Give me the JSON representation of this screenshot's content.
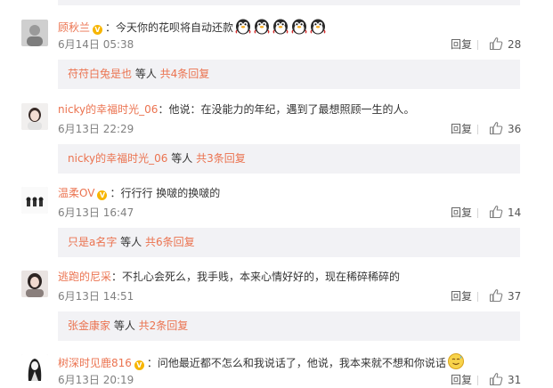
{
  "comments": [
    {
      "username": "顾秋兰",
      "text": "：今天你的花呗将自动还款",
      "emoji_count": 5,
      "time": "6月14日 05:38",
      "reply_label": "回复",
      "likes": "28",
      "sub": {
        "name": "苻苻白兔是也",
        "mid": " 等人 ",
        "total": "共4条回复"
      }
    },
    {
      "username": "nicky的幸福时光_06",
      "text": "：他说：在没能力的年纪，遇到了最想照顾一生的人。",
      "time": "6月13日 22:29",
      "reply_label": "回复",
      "likes": "36",
      "sub": {
        "name": "nicky的幸福时光_06",
        "mid": " 等人 ",
        "total": "共3条回复"
      }
    },
    {
      "username": "温柔OV",
      "text": "：行行行 换啵的换啵的",
      "time": "6月13日 16:47",
      "reply_label": "回复",
      "likes": "14",
      "sub": {
        "name": "只是a名字",
        "mid": " 等人 ",
        "total": "共6条回复"
      }
    },
    {
      "username": "逃跑的尼采",
      "text": "：不扎心会死么，我手贱，本来心情好好的，现在稀碎稀碎的",
      "time": "6月13日 14:51",
      "reply_label": "回复",
      "likes": "37",
      "sub": {
        "name": "张金康家",
        "mid": " 等人 ",
        "total": "共2条回复"
      }
    },
    {
      "username": "树深时见鹿816",
      "text": "：问他最近都不怎么和我说话了，他说，我本来就不想和你说话",
      "time": "6月13日 20:19",
      "reply_label": "回复",
      "likes": "31"
    }
  ],
  "colors": {
    "link": "#eb7350",
    "subbox_bg": "#f2f2f5",
    "vip": "#f7b500"
  }
}
